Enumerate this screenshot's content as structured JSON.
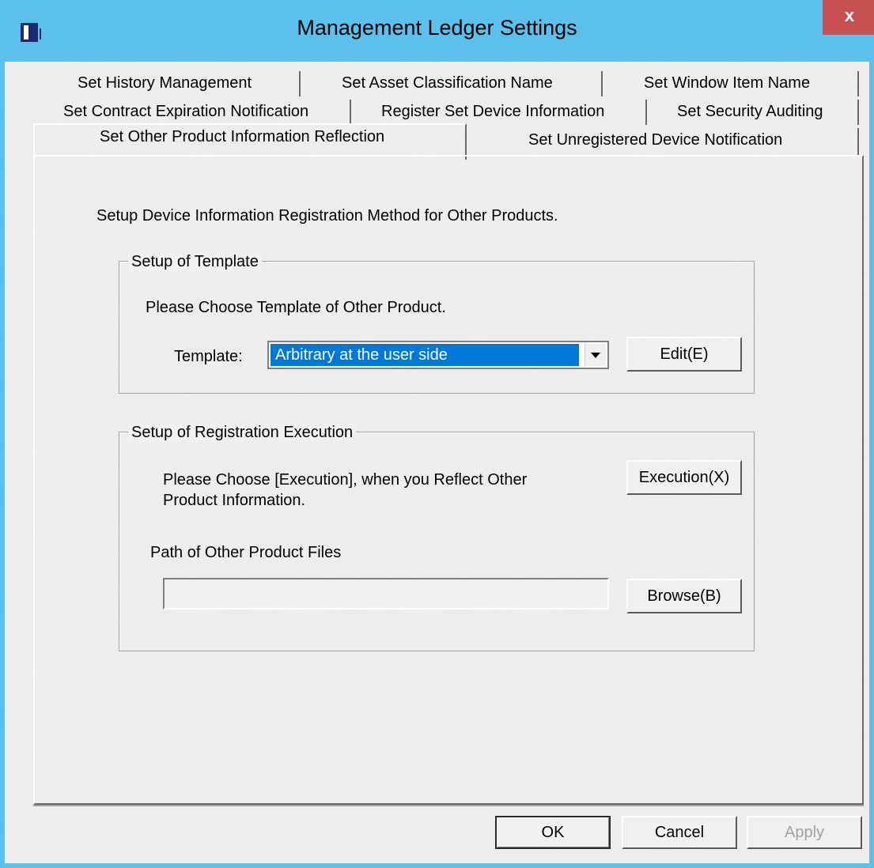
{
  "window": {
    "title": "Management Ledger Settings",
    "close_label": "x",
    "icon": "ledger-app-icon"
  },
  "tabs": {
    "row1": [
      "Set History Management",
      "Set Asset Classification Name",
      "Set Window Item Name"
    ],
    "row2": [
      "Set Contract Expiration Notification",
      "Register Set Device Information",
      "Set Security Auditing"
    ],
    "row3": [
      "Set Other Product Information Reflection",
      "Set Unregistered Device Notification"
    ],
    "active": "Set Other Product Information Reflection"
  },
  "panel": {
    "heading": "Setup Device Information Registration Method for Other Products.",
    "template_group": {
      "title": "Setup of Template",
      "instruction": "Please Choose Template of Other Product.",
      "template_label": "Template:",
      "template_value": "Arbitrary at the user side",
      "edit_button": "Edit(E)"
    },
    "execution_group": {
      "title": "Setup of Registration Execution",
      "instruction_line1": "Please Choose [Execution], when you Reflect Other",
      "instruction_line2": "Product Information.",
      "execution_button": "Execution(X)",
      "path_label": "Path of Other Product Files",
      "path_value": "",
      "browse_button": "Browse(B)"
    }
  },
  "footer": {
    "ok": "OK",
    "cancel": "Cancel",
    "apply": "Apply"
  },
  "colors": {
    "titlebar": "#5bc0ec",
    "close": "#c75050",
    "selection": "#0078d7"
  }
}
